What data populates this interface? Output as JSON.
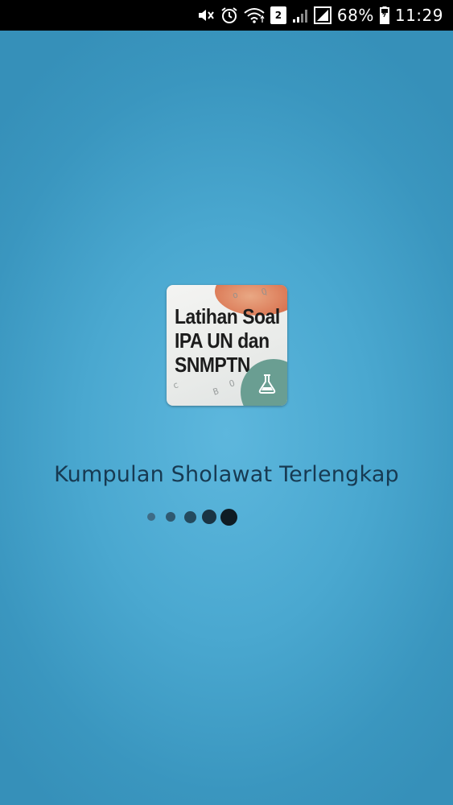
{
  "status_bar": {
    "battery_percent": "68%",
    "time": "11:29",
    "sim_badge": "2",
    "icons": [
      "mute-icon",
      "alarm-icon",
      "wifi-icon",
      "sim-badge",
      "signal-weak-icon",
      "signal-icon",
      "battery-icon"
    ]
  },
  "app_logo": {
    "lines": [
      "Latihan Soal",
      "IPA UN dan",
      "SNMPTN"
    ],
    "scribbles": [
      "Q",
      "o",
      "B",
      "O",
      "c"
    ]
  },
  "app_name": "Kumpulan Sholawat Terlengkap",
  "loader": {
    "dot_count": 5,
    "active_index": 4
  },
  "colors": {
    "status_bar_bg": "#000000",
    "splash_center": "#5db7dd",
    "splash_edge": "#3690b9",
    "app_name_text": "#173a52",
    "badge_green": "#6a9e92",
    "logo_accent_orange": "#d9724f"
  }
}
